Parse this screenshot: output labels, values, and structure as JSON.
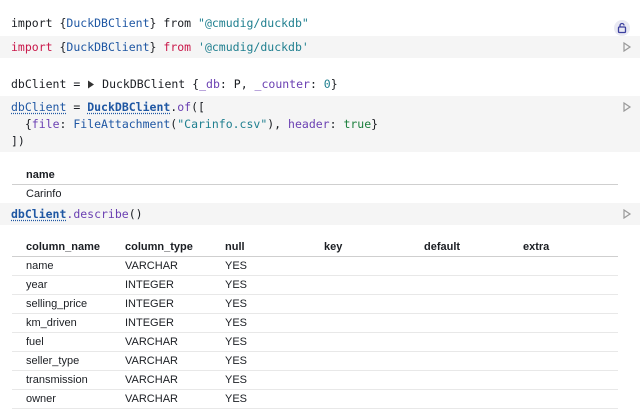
{
  "cell1": {
    "output": {
      "import": "import",
      "brace_open": "{",
      "name": "DuckDBClient",
      "brace_close": "}",
      "from": "from",
      "source": "\"@cmudig/duckdb\""
    },
    "code": {
      "import": "import",
      "brace_open": "{",
      "name": "DuckDBClient",
      "brace_close": "}",
      "from": "from",
      "source": "'@cmudig/duckdb'"
    }
  },
  "cell2": {
    "output": {
      "var": "dbClient",
      "eq": "=",
      "cls": "DuckDBClient",
      "open": "{",
      "k1": "_db",
      "v1": "P",
      "k2": "_counter",
      "v2": "0",
      "close": "}"
    },
    "code": {
      "var": "dbClient",
      "eq": "=",
      "cls": "DuckDBClient",
      "method": "of",
      "open": "([",
      "line2_open": "{",
      "file_key": "file",
      "fa": "FileAttachment",
      "fa_open": "(",
      "file_str": "\"Carinfo.csv\"",
      "fa_close": "),",
      "header_key": "header",
      "header_val": "true",
      "line2_close": "}",
      "line3": "])"
    }
  },
  "cell2_table": {
    "header": "name",
    "rows": [
      "Carinfo"
    ]
  },
  "cell3": {
    "code": {
      "obj": "dbClient",
      "dot_method": ".describe",
      "args": "()"
    }
  },
  "describe_table": {
    "headers": [
      "column_name",
      "column_type",
      "null",
      "key",
      "default",
      "extra"
    ],
    "rows": [
      [
        "name",
        "VARCHAR",
        "YES"
      ],
      [
        "year",
        "INTEGER",
        "YES"
      ],
      [
        "selling_price",
        "INTEGER",
        "YES"
      ],
      [
        "km_driven",
        "INTEGER",
        "YES"
      ],
      [
        "fuel",
        "VARCHAR",
        "YES"
      ],
      [
        "seller_type",
        "VARCHAR",
        "YES"
      ],
      [
        "transmission",
        "VARCHAR",
        "YES"
      ],
      [
        "owner",
        "VARCHAR",
        "YES"
      ]
    ]
  }
}
